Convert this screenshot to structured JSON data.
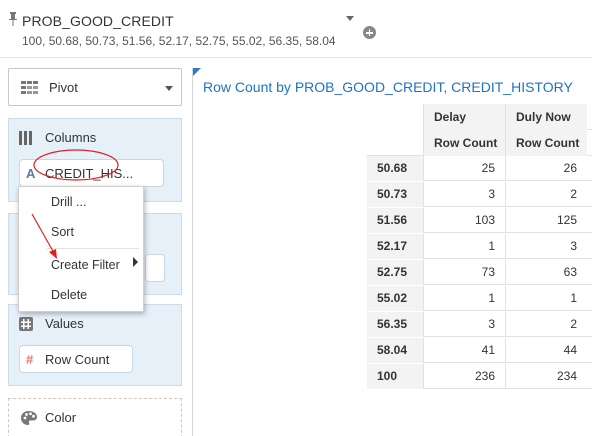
{
  "filter": {
    "title": "PROB_GOOD_CREDIT",
    "values": "100, 50.68, 50.73, 51.56, 52.17, 52.75, 55.02, 56.35, 58.04"
  },
  "left_panel": {
    "viz_type": "Pivot",
    "columns": {
      "label": "Columns",
      "field": "CREDIT_HIS..."
    },
    "values": {
      "label": "Values",
      "field": "Row Count"
    },
    "color": {
      "label": "Color"
    }
  },
  "context_menu": {
    "items": [
      "Drill ...",
      "Sort",
      "Create Filter",
      "Delete"
    ]
  },
  "viz": {
    "title": "Row Count by PROB_GOOD_CREDIT, CREDIT_HISTORY",
    "columns": [
      "Delay",
      "Duly Now"
    ],
    "measure": "Row Count",
    "rows": [
      {
        "label": "50.68",
        "values": [
          "25",
          "26"
        ]
      },
      {
        "label": "50.73",
        "values": [
          "3",
          "2"
        ]
      },
      {
        "label": "51.56",
        "values": [
          "103",
          "125"
        ]
      },
      {
        "label": "52.17",
        "values": [
          "1",
          "3"
        ]
      },
      {
        "label": "52.75",
        "values": [
          "73",
          "63"
        ]
      },
      {
        "label": "55.02",
        "values": [
          "1",
          "1"
        ]
      },
      {
        "label": "56.35",
        "values": [
          "3",
          "2"
        ]
      },
      {
        "label": "58.04",
        "values": [
          "41",
          "44"
        ]
      },
      {
        "label": "100",
        "values": [
          "236",
          "234"
        ]
      }
    ]
  },
  "colors": {
    "accent": "#1f73c4",
    "section_bg": "#e6f0f9",
    "annotation": "#e02020"
  },
  "icons": {
    "pin": "pin-icon",
    "add": "plus-circle-icon",
    "pivot": "grid-icon",
    "columns": "columns-icon",
    "values": "hash-icon",
    "color": "palette-icon",
    "field_type": "attribute-a-icon",
    "measure": "hash-icon"
  }
}
